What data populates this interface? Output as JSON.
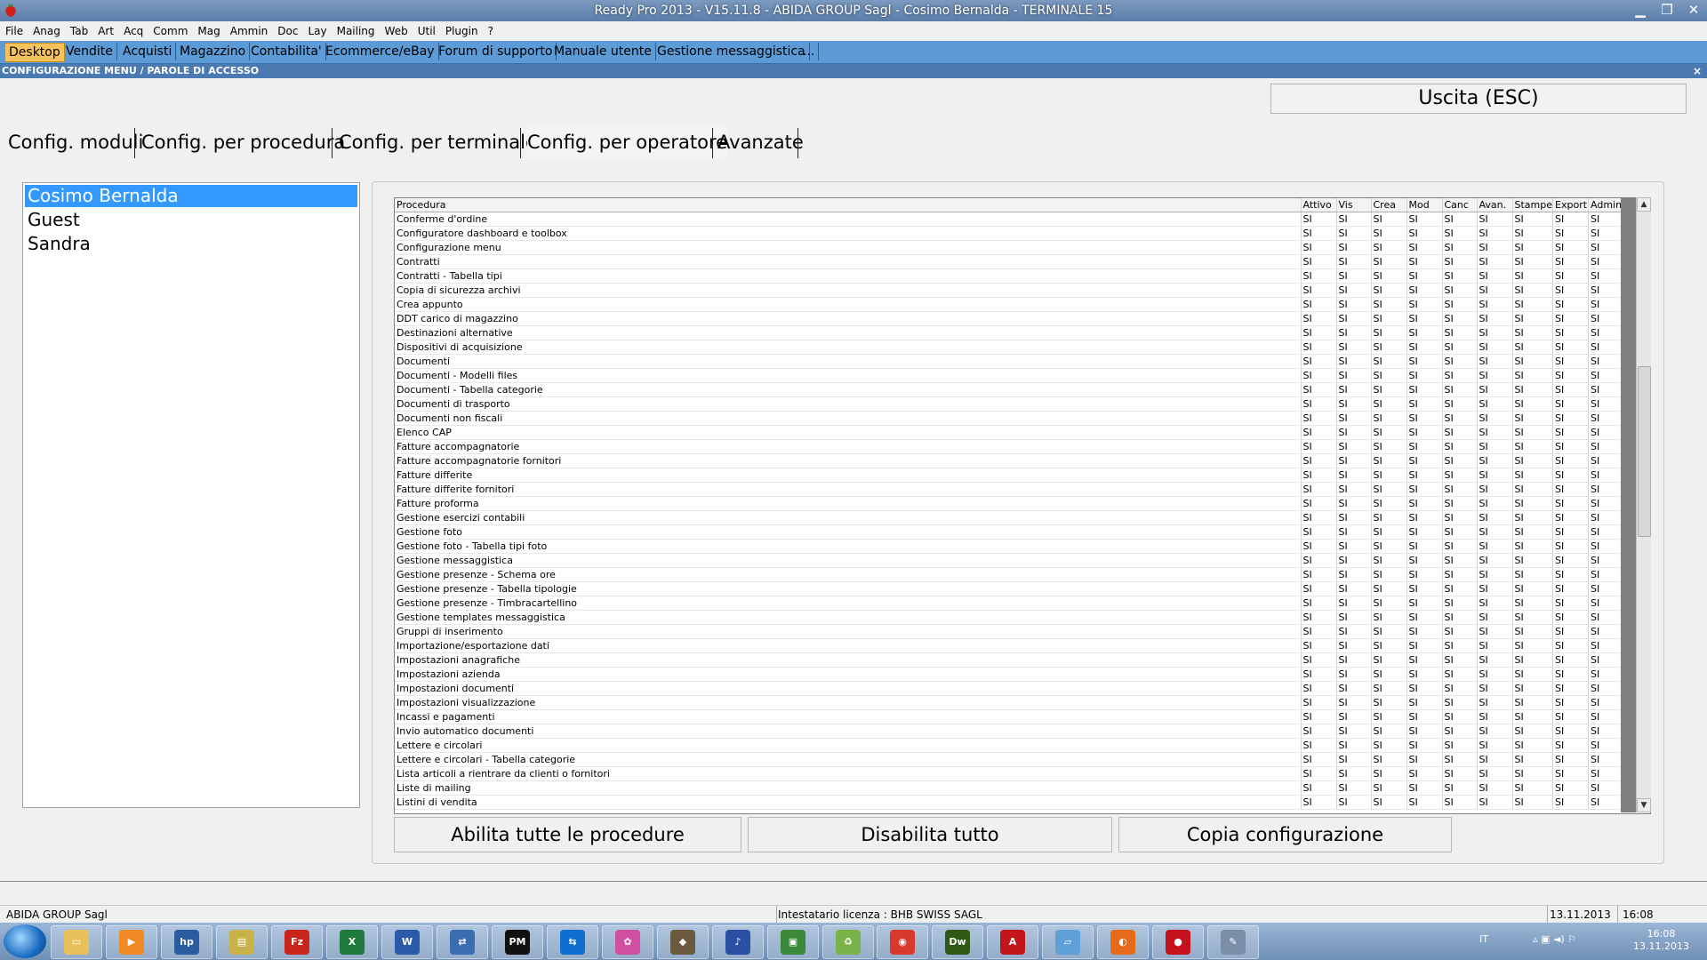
{
  "window": {
    "title": "Ready Pro 2013 - V15.11.8 - ABIDA GROUP Sagl - Cosimo Bernalda - TERMINALE 15",
    "controls": [
      "minimize-icon",
      "restore-icon",
      "close-icon"
    ]
  },
  "menu": [
    "File",
    "Anag",
    "Tab",
    "Art",
    "Acq",
    "Comm",
    "Mag",
    "Ammin",
    "Doc",
    "Lay",
    "Mailing",
    "Web",
    "Util",
    "Plugin",
    "?"
  ],
  "quick_tabs": [
    {
      "label": "Desktop",
      "active": true
    },
    {
      "label": "Vendite"
    },
    {
      "label": "Acquisti"
    },
    {
      "label": "Magazzino"
    },
    {
      "label": "Contabilita'"
    },
    {
      "label": "Ecommerce/eBay"
    },
    {
      "label": "Forum di supporto"
    },
    {
      "label": "Manuale utente"
    },
    {
      "label": "Gestione messaggistica"
    },
    {
      "label": "..."
    }
  ],
  "section_title": "CONFIGURAZIONE MENU / PAROLE DI ACCESSO",
  "section_close": "×",
  "exit_button": "Uscita (ESC)",
  "config_tabs": [
    {
      "label": "Config. moduli"
    },
    {
      "label": "Config. per procedura"
    },
    {
      "label": "Config. per terminale"
    },
    {
      "label": "Config. per operatore",
      "active": true
    },
    {
      "label": "Avanzate"
    }
  ],
  "users": [
    {
      "name": "Cosimo Bernalda",
      "selected": true
    },
    {
      "name": "Guest"
    },
    {
      "name": "Sandra"
    }
  ],
  "grid": {
    "columns": [
      "Procedura",
      "Attivo",
      "Vis",
      "Crea",
      "Mod",
      "Canc",
      "Avan.",
      "Stampe",
      "Export",
      "Admin"
    ],
    "value": "SI",
    "rows": [
      "Conferme d'ordine",
      "Configuratore dashboard e toolbox",
      "Configurazione menu",
      "Contratti",
      "Contratti - Tabella tipi",
      "Copia di sicurezza archivi",
      "Crea appunto",
      "DDT carico di magazzino",
      "Destinazioni alternative",
      "Dispositivi di acquisizione",
      "Documenti",
      "Documenti - Modelli files",
      "Documenti - Tabella categorie",
      "Documenti di trasporto",
      "Documenti non fiscali",
      "Elenco CAP",
      "Fatture accompagnatorie",
      "Fatture accompagnatorie fornitori",
      "Fatture differite",
      "Fatture differite fornitori",
      "Fatture proforma",
      "Gestione esercizi contabili",
      "Gestione foto",
      "Gestione foto - Tabella tipi foto",
      "Gestione messaggistica",
      "Gestione presenze - Schema ore",
      "Gestione presenze - Tabella tipologie",
      "Gestione presenze - Timbracartellino",
      "Gestione templates messaggistica",
      "Gruppi di inserimento",
      "Importazione/esportazione dati",
      "Impostazioni anagrafiche",
      "Impostazioni azienda",
      "Impostazioni documenti",
      "Impostazioni visualizzazione",
      "Incassi e pagamenti",
      "Invio automatico documenti",
      "Lettere e circolari",
      "Lettere e circolari - Tabella categorie",
      "Lista articoli a rientrare da clienti o fornitori",
      "Liste di mailing",
      "Listini di vendita"
    ]
  },
  "buttons": {
    "enable_all": "Abilita tutte le procedure",
    "disable_all": "Disabilita tutto",
    "copy_config": "Copia configurazione"
  },
  "status": {
    "company": "ABIDA GROUP Sagl",
    "license": "Intestatario licenza : BHB SWISS SAGL",
    "date": "13.11.2013",
    "time": "16:08"
  },
  "taskbar": {
    "language": "IT",
    "clock_time": "16:08",
    "clock_date": "13.11.2013",
    "apps": [
      {
        "icon": "explorer-icon",
        "glyph": "▭",
        "color": "#e8c15a"
      },
      {
        "icon": "media-player-icon",
        "glyph": "▶",
        "color": "#f08a24"
      },
      {
        "icon": "hp-icon",
        "glyph": "hp",
        "color": "#2a5d9f"
      },
      {
        "icon": "scanner-icon",
        "glyph": "▤",
        "color": "#c9b24a"
      },
      {
        "icon": "filezilla-icon",
        "glyph": "Fz",
        "color": "#c8251b"
      },
      {
        "icon": "excel-icon",
        "glyph": "X",
        "color": "#1d7a3c"
      },
      {
        "icon": "word-icon",
        "glyph": "W",
        "color": "#2a5aa8"
      },
      {
        "icon": "network-icon",
        "glyph": "⇄",
        "color": "#3b6db0"
      },
      {
        "icon": "pm-icon",
        "glyph": "PM",
        "color": "#111111"
      },
      {
        "icon": "teamviewer-icon",
        "glyph": "⇆",
        "color": "#0e6fd1"
      },
      {
        "icon": "picasa-icon",
        "glyph": "✿",
        "color": "#d04fa0"
      },
      {
        "icon": "gimp-icon",
        "glyph": "◆",
        "color": "#6b5a3e"
      },
      {
        "icon": "itunes-icon",
        "glyph": "♪",
        "color": "#2b4fa3"
      },
      {
        "icon": "monitor-icon",
        "glyph": "▣",
        "color": "#3a8a3a"
      },
      {
        "icon": "recycle-icon",
        "glyph": "♻",
        "color": "#7ab34a"
      },
      {
        "icon": "chrome-icon",
        "glyph": "◉",
        "color": "#d9382c"
      },
      {
        "icon": "dreamweaver-icon",
        "glyph": "Dw",
        "color": "#2e5a16"
      },
      {
        "icon": "acrobat-icon",
        "glyph": "A",
        "color": "#c3161b"
      },
      {
        "icon": "notepad-icon",
        "glyph": "▱",
        "color": "#5fa0d8"
      },
      {
        "icon": "firefox-icon",
        "glyph": "◐",
        "color": "#e56a1a"
      },
      {
        "icon": "readypro-icon",
        "glyph": "●",
        "color": "#c4121e"
      },
      {
        "icon": "paint-icon",
        "glyph": "✎",
        "color": "#7a8ea8"
      }
    ]
  }
}
